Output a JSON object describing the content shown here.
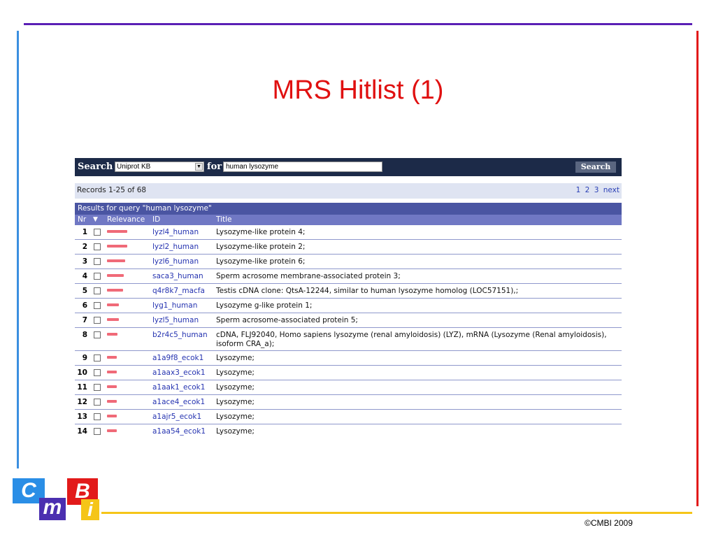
{
  "slide": {
    "title": "MRS Hitlist (1)",
    "copyright": "©CMBI 2009",
    "logo": {
      "c": "C",
      "m": "m",
      "b": "B",
      "i": "i"
    }
  },
  "search": {
    "label": "Search",
    "database": "Uniprot KB",
    "for_label": "for",
    "query": "human lysozyme",
    "button": "Search"
  },
  "records": {
    "summary": "Records 1-25 of 68",
    "pages": [
      "1",
      "2",
      "3"
    ],
    "next": "next"
  },
  "results": {
    "header": "Results for query \"human lysozyme\"",
    "columns": {
      "nr": "Nr",
      "relevance": "Relevance",
      "id": "ID",
      "title": "Title"
    },
    "rows": [
      {
        "nr": "1",
        "id": "lyzl4_human",
        "title": "Lysozyme-like protein 4;",
        "relevance": 0.95
      },
      {
        "nr": "2",
        "id": "lyzl2_human",
        "title": "Lysozyme-like protein 2;",
        "relevance": 0.95
      },
      {
        "nr": "3",
        "id": "lyzl6_human",
        "title": "Lysozyme-like protein 6;",
        "relevance": 0.85
      },
      {
        "nr": "4",
        "id": "saca3_human",
        "title": "Sperm acrosome membrane-associated protein 3;",
        "relevance": 0.8
      },
      {
        "nr": "5",
        "id": "q4r8k7_macfa",
        "title": "Testis cDNA clone: QtsA-12244, similar to human lysozyme homolog (LOC57151),;",
        "relevance": 0.75
      },
      {
        "nr": "6",
        "id": "lyg1_human",
        "title": "Lysozyme g-like protein 1;",
        "relevance": 0.55
      },
      {
        "nr": "7",
        "id": "lyzl5_human",
        "title": "Sperm acrosome-associated protein 5;",
        "relevance": 0.55
      },
      {
        "nr": "8",
        "id": "b2r4c5_human",
        "title": "cDNA, FLJ92040, Homo sapiens lysozyme (renal amyloidosis) (LYZ), mRNA (Lysozyme (Renal amyloidosis), isoform CRA_a);",
        "relevance": 0.5
      },
      {
        "nr": "9",
        "id": "a1a9f8_ecok1",
        "title": "Lysozyme;",
        "relevance": 0.45
      },
      {
        "nr": "10",
        "id": "a1aax3_ecok1",
        "title": "Lysozyme;",
        "relevance": 0.45
      },
      {
        "nr": "11",
        "id": "a1aak1_ecok1",
        "title": "Lysozyme;",
        "relevance": 0.45
      },
      {
        "nr": "12",
        "id": "a1ace4_ecok1",
        "title": "Lysozyme;",
        "relevance": 0.45
      },
      {
        "nr": "13",
        "id": "a1ajr5_ecok1",
        "title": "Lysozyme;",
        "relevance": 0.45
      },
      {
        "nr": "14",
        "id": "a1aa54_ecok1",
        "title": "Lysozyme;",
        "relevance": 0.45
      }
    ]
  },
  "colors": {
    "frame_top": "#5a1fb5",
    "frame_left": "#3b8fe0",
    "frame_right": "#e21a1a",
    "frame_bottom": "#f5c518",
    "title": "#e01010",
    "relevance_bar": "#f06a78",
    "link": "#2533b0"
  }
}
